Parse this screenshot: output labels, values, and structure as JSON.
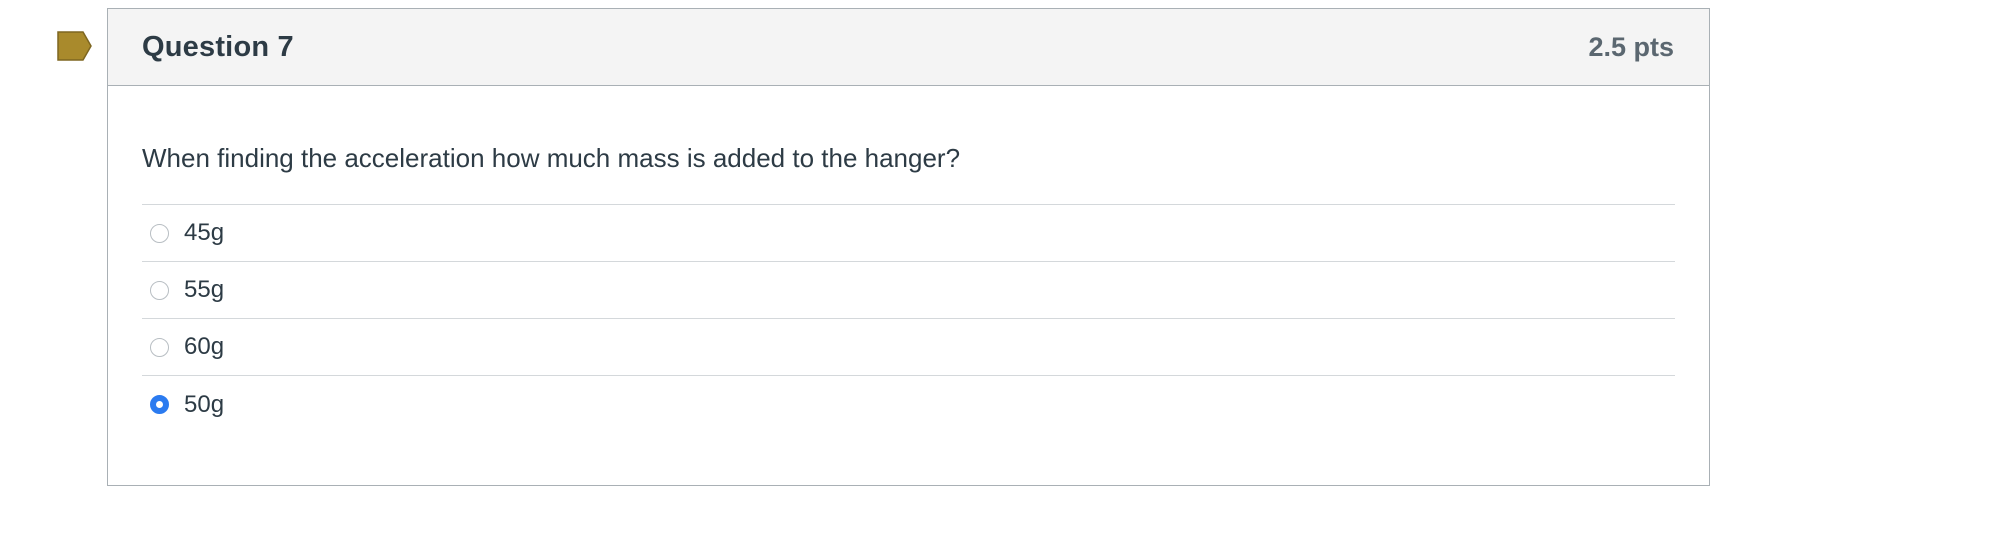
{
  "question": {
    "title": "Question 7",
    "points": "2.5 pts",
    "text": "When finding the acceleration how much mass is added to the hanger?",
    "flag_color": "#a98a2c",
    "selected_color": "#2b7bf0",
    "answers": [
      {
        "label": "45g",
        "selected": false
      },
      {
        "label": "55g",
        "selected": false
      },
      {
        "label": "60g",
        "selected": false
      },
      {
        "label": "50g",
        "selected": true
      }
    ]
  }
}
